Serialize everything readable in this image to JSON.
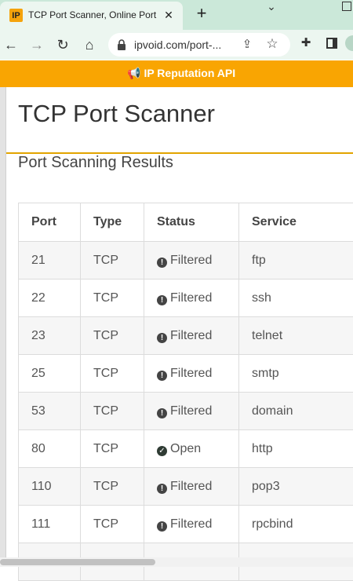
{
  "browser": {
    "tab_title": "TCP Port Scanner, Online Port",
    "favicon_text": "IP",
    "tab_close": "✕",
    "new_tab": "+",
    "url": "ipvoid.com/port-...",
    "icons": [
      "back-arrow-icon",
      "forward-arrow-icon",
      "reload-icon",
      "home-icon",
      "lock-icon",
      "share-icon",
      "star-icon",
      "extensions-icon",
      "side-panel-icon"
    ]
  },
  "banner": {
    "text": "IP Reputation API",
    "icon": "megaphone-icon",
    "color": "#f9a502"
  },
  "page": {
    "title": "TCP Port Scanner",
    "results_title": "Port Scanning Results"
  },
  "table": {
    "headers": [
      "Port",
      "Type",
      "Status",
      "Service"
    ],
    "rows": [
      {
        "port": "21",
        "type": "TCP",
        "status": "Filtered",
        "service": "ftp"
      },
      {
        "port": "22",
        "type": "TCP",
        "status": "Filtered",
        "service": "ssh"
      },
      {
        "port": "23",
        "type": "TCP",
        "status": "Filtered",
        "service": "telnet"
      },
      {
        "port": "25",
        "type": "TCP",
        "status": "Filtered",
        "service": "smtp"
      },
      {
        "port": "53",
        "type": "TCP",
        "status": "Filtered",
        "service": "domain"
      },
      {
        "port": "80",
        "type": "TCP",
        "status": "Open",
        "service": "http"
      },
      {
        "port": "110",
        "type": "TCP",
        "status": "Filtered",
        "service": "pop3"
      },
      {
        "port": "111",
        "type": "TCP",
        "status": "Filtered",
        "service": "rpcbind"
      },
      {
        "port": "",
        "type": "",
        "status": "",
        "service": ""
      }
    ]
  },
  "colors": {
    "accent": "#f9a502",
    "tab_strip": "#cbe8d9",
    "toolbar": "#ecf6f0"
  }
}
